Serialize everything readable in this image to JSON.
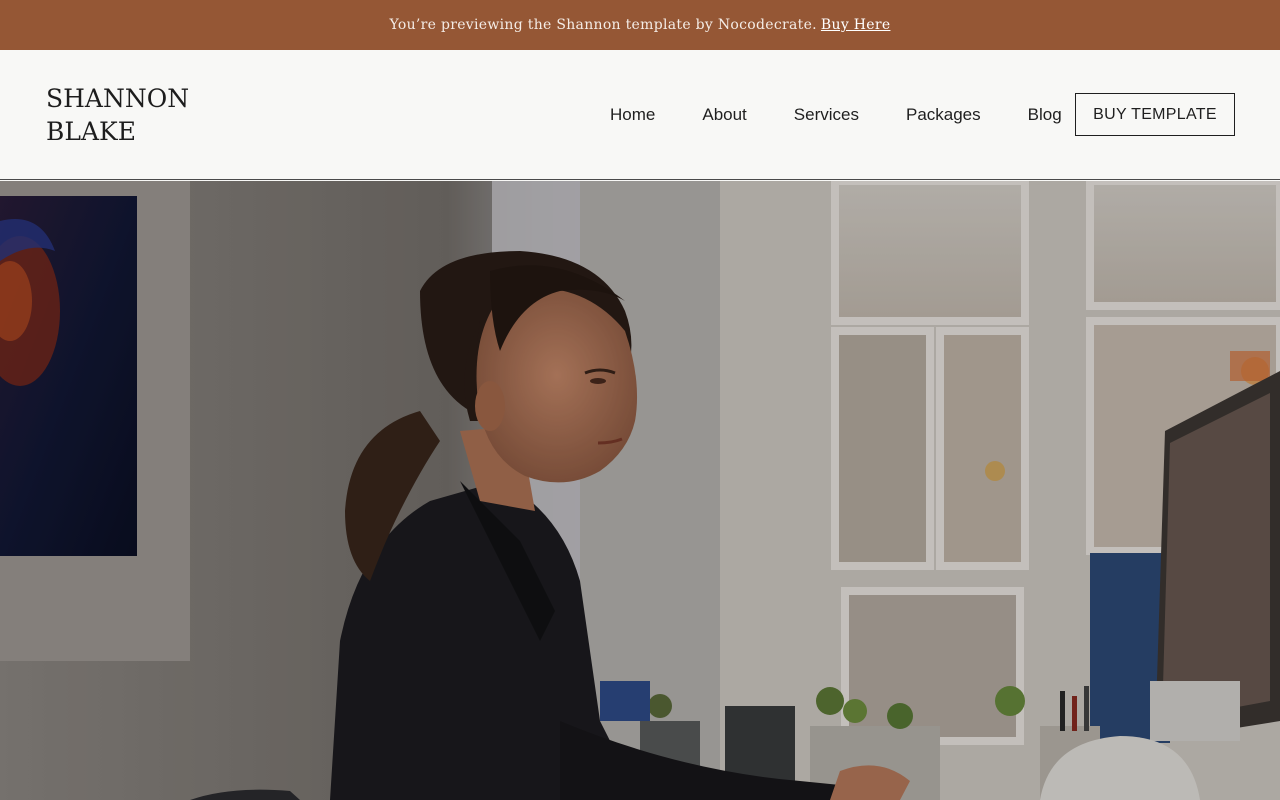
{
  "banner": {
    "text": "You’re previewing the Shannon template by Nocodecrate.",
    "link_label": "Buy Here"
  },
  "header": {
    "logo_line1": "SHANNON",
    "logo_line2": "BLAKE",
    "nav": [
      {
        "label": "Home"
      },
      {
        "label": "About"
      },
      {
        "label": "Services"
      },
      {
        "label": "Packages"
      },
      {
        "label": "Blog"
      }
    ],
    "cta_label": "BUY TEMPLATE"
  },
  "colors": {
    "banner_bg": "#955735",
    "header_bg": "#f8f8f6",
    "text_dark": "#1f1f1f"
  }
}
